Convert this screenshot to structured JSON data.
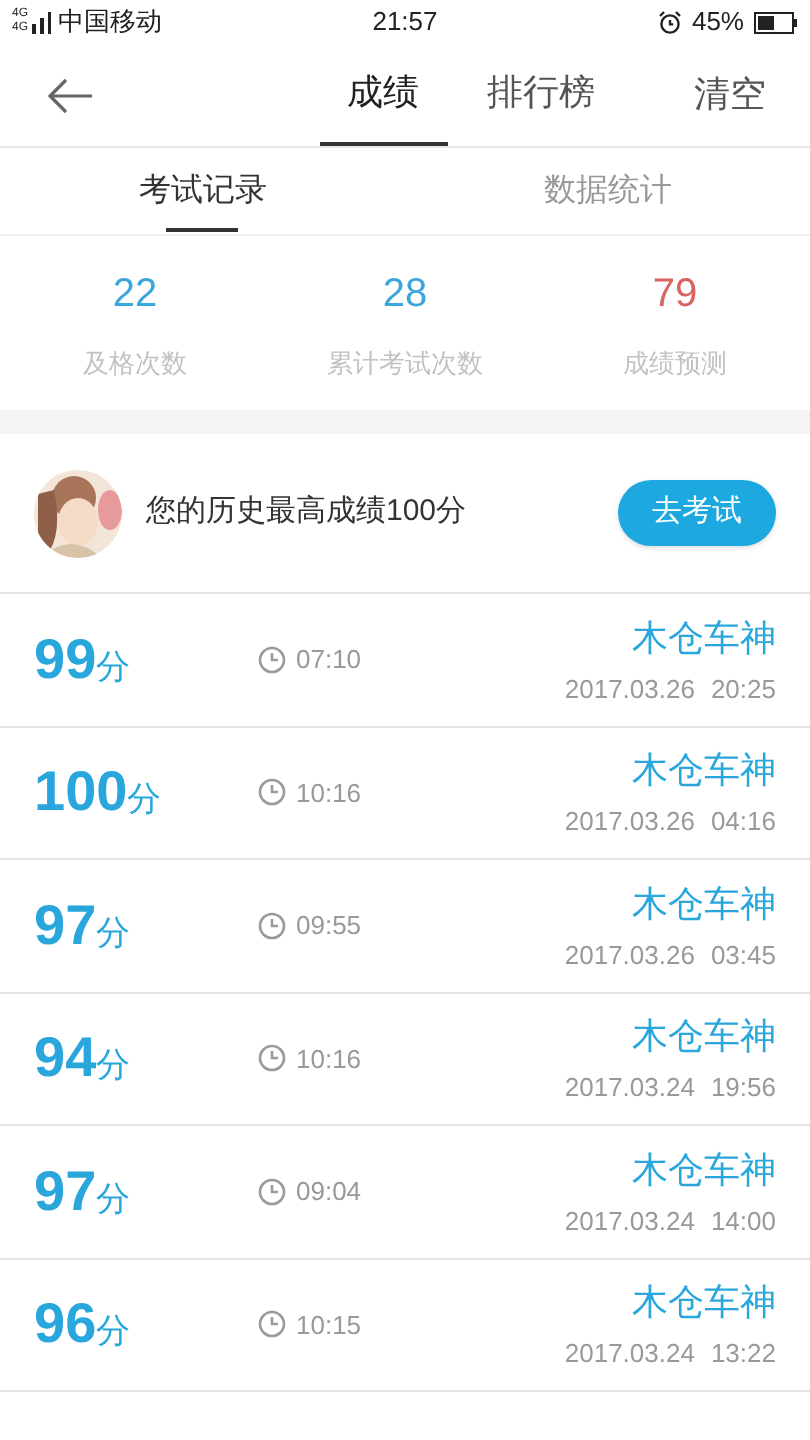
{
  "status_bar": {
    "network_labels": [
      "4G",
      "4G"
    ],
    "carrier": "中国移动",
    "time": "21:57",
    "battery": "45%"
  },
  "header": {
    "tabs": [
      {
        "label": "成绩",
        "selected": true
      },
      {
        "label": "排行榜",
        "selected": false
      }
    ],
    "action": "清空"
  },
  "sub_tabs": [
    {
      "label": "考试记录",
      "selected": true
    },
    {
      "label": "数据统计",
      "selected": false
    }
  ],
  "stats": [
    {
      "value": "22",
      "label": "及格次数",
      "color": "#3aa6dc"
    },
    {
      "value": "28",
      "label": "累计考试次数",
      "color": "#3aa6dc"
    },
    {
      "value": "79",
      "label": "成绩预测",
      "color": "#d9635f"
    }
  ],
  "best": {
    "text": "您的历史最高成绩100分",
    "button": "去考试"
  },
  "records": [
    {
      "score": "99",
      "unit": "分",
      "duration": "07:10",
      "name": "木仓车神",
      "date": "2017.03.26",
      "time": "20:25"
    },
    {
      "score": "100",
      "unit": "分",
      "duration": "10:16",
      "name": "木仓车神",
      "date": "2017.03.26",
      "time": "04:16"
    },
    {
      "score": "97",
      "unit": "分",
      "duration": "09:55",
      "name": "木仓车神",
      "date": "2017.03.26",
      "time": "03:45"
    },
    {
      "score": "94",
      "unit": "分",
      "duration": "10:16",
      "name": "木仓车神",
      "date": "2017.03.24",
      "time": "19:56"
    },
    {
      "score": "97",
      "unit": "分",
      "duration": "09:04",
      "name": "木仓车神",
      "date": "2017.03.24",
      "time": "14:00"
    },
    {
      "score": "96",
      "unit": "分",
      "duration": "10:15",
      "name": "木仓车神",
      "date": "2017.03.24",
      "time": "13:22"
    }
  ]
}
